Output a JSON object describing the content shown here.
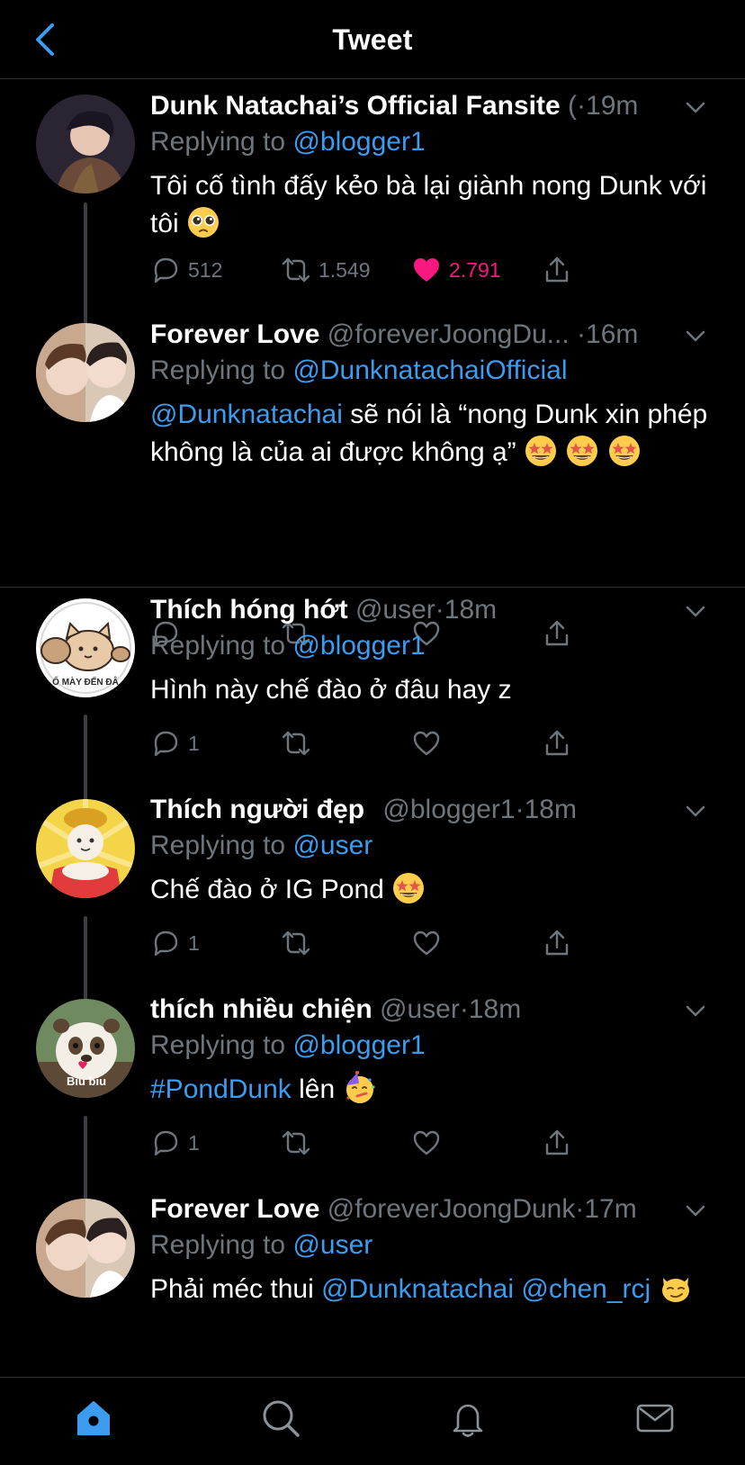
{
  "header": {
    "title": "Tweet"
  },
  "tweets": [
    {
      "name": "Dunk Natachai’s Official Fansite",
      "handle": "(",
      "time": "·19m",
      "reply_prefix": "Replying to",
      "reply_to": "@blogger1",
      "text": "Tôi cố tình đấy kẻo bà lại giành nong Dunk với tôi",
      "emojis": [
        "pleading-face"
      ],
      "reply_count": "512",
      "retweet_count": "1.549",
      "like_count": "2.791",
      "liked": true
    },
    {
      "name": "Forever Love",
      "handle": "@foreverJoongDu...",
      "time": "·16m",
      "reply_prefix": "Replying to",
      "reply_to": "@DunknatachaiOfficial",
      "mention": "@Dunknatachai",
      "text": " sẽ nói là “nong Dunk xin phép không là của ai được không ạ”",
      "emojis": [
        "star-struck",
        "star-struck",
        "star-struck"
      ]
    },
    {
      "name": "Thích hóng hớt",
      "handle": "@user",
      "time": "·18m",
      "reply_prefix": "Replying to",
      "reply_to": "@blogger1",
      "text": "Hình này chế đào ở đâu hay z",
      "avatar_text": "Ố MÀY ĐẾN ĐÂ",
      "reply_count": "1"
    },
    {
      "name": "Thích người đẹp",
      "handle": "@blogger1",
      "time": "·18m",
      "reply_prefix": "Replying to",
      "reply_to": "@user",
      "text": "Chế đào ở IG Pond",
      "emojis": [
        "star-struck"
      ],
      "reply_count": "1"
    },
    {
      "name": "thích nhiều chiện",
      "handle": "@user",
      "time": "·18m",
      "reply_prefix": "Replying to",
      "reply_to": "@blogger1",
      "hashtag": "#PondDunk",
      "text": " lên",
      "emojis": [
        "partying-face"
      ],
      "avatar_text": "Biu biu",
      "reply_count": "1"
    },
    {
      "name": "Forever Love",
      "handle": "@foreverJoongDunk",
      "time": "·17m",
      "reply_prefix": "Replying to",
      "reply_to": "@user",
      "text": "Phải méc thui ",
      "mention1": "@Dunknatachai",
      "mention2": "@chen_rcj",
      "emojis": [
        "smirking-cat"
      ]
    }
  ],
  "colors": {
    "accent": "#3b9cf0",
    "like": "#f91880",
    "muted": "#6e767d",
    "background": "#000000",
    "divider": "#2f3336"
  },
  "tabs": [
    "home-icon",
    "search-icon",
    "notifications-icon",
    "messages-icon"
  ]
}
